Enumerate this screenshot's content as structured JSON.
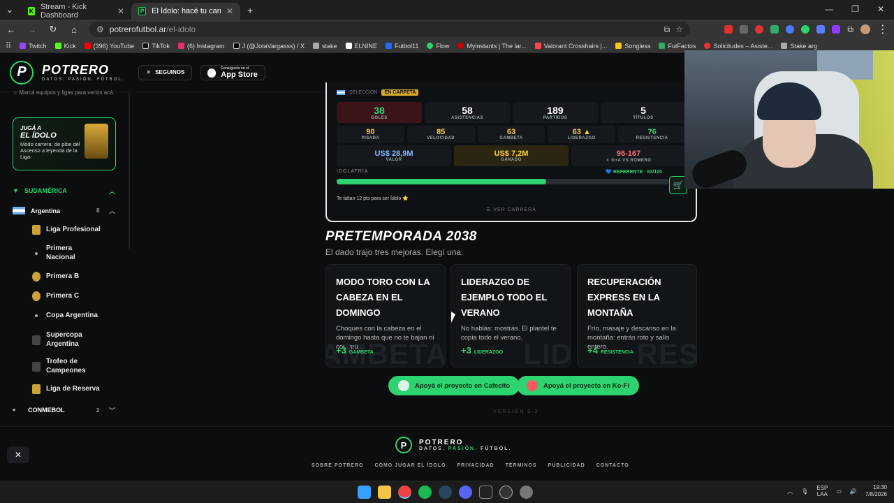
{
  "browser": {
    "tabs": [
      {
        "label": "Stream - Kick Dashboard",
        "active": false
      },
      {
        "label": "El Ídolo: hacé tu carrera en la Li",
        "active": true
      }
    ],
    "new_tab": "+",
    "url_host": "potrerofutbol.ar",
    "url_path": "/el-idolo",
    "bookmarks": [
      "Twitch",
      "Kick",
      "(396) YouTube",
      "TikTok",
      "(6) Instagram",
      "J (@JotaVargasss) / X",
      "stake",
      "ELNINE",
      "Futbol11",
      "Flow",
      "Myinstants | The lar...",
      "Valorant Crosshairs |...",
      "Songless",
      "FutFactos",
      "Solicitudes – Asiste...",
      "Stake arg"
    ]
  },
  "site": {
    "logo_letter": "P",
    "name": "POTRERO",
    "tagline": "DATOS. PASIÓN. FÚTBOL.",
    "follow_label": "SEGUINOS",
    "appstore_small": "Consiguelo en el",
    "appstore_big": "App Store"
  },
  "sidebar": {
    "note": "Marcá equipos y ligas para verlos acá.",
    "promo_kicker": "JUGÁ A",
    "promo_title": "EL ÍDOLO",
    "promo_desc": "Modo carrera: de pibe del Ascenso a leyenda de la Liga",
    "region": "SUDAMÉRICA",
    "country": "Argentina",
    "country_count": "8",
    "leagues": [
      "Liga Profesional",
      "Primera Nacional",
      "Primera B",
      "Primera C",
      "Copa Argentina",
      "Supercopa Argentina",
      "Trofeo de Campeones",
      "Liga de Reserva"
    ],
    "conmebol": "CONMEBOL",
    "conmebol_count": "2"
  },
  "career": {
    "selection": "SELECCIÓN",
    "status_badge": "EN CARPETA",
    "main_stats": [
      {
        "value": "38",
        "label": "GOLES"
      },
      {
        "value": "58",
        "label": "ASISTENCIAS"
      },
      {
        "value": "189",
        "label": "PARTIDOS"
      },
      {
        "value": "5",
        "label": "TÍTULOS"
      }
    ],
    "attrs": [
      {
        "value": "90",
        "label": "PISADA"
      },
      {
        "value": "85",
        "label": "VELOCIDAD"
      },
      {
        "value": "63",
        "label": "GAMBETA"
      },
      {
        "value": "63 ▲",
        "label": "LIDERAZGO"
      },
      {
        "value": "76",
        "label": "RESISTENCIA"
      }
    ],
    "valor": "US$ 28,9M",
    "valor_label": "VALOR",
    "ganado": "US$ 7,2M",
    "ganado_label": "GANADO",
    "rival_score": "96-167",
    "rival_label": "✕ G+A VS ROMERO",
    "idolatry_label": "IDOLATRÍA",
    "referente": "💙 REFERENTE · 63/100",
    "idolatry_pct": 63,
    "faltan": "Te faltan 12 pts para ser Ídolo ⭐",
    "ver_carrera": "☰ VER CARRERA"
  },
  "preseason": {
    "title": "PRETEMPORADA 2038",
    "subtitle": "El dado trajo tres mejoras. Elegí una.",
    "options": [
      {
        "title": "MODO TORO CON LA CABEZA EN EL DOMINGO",
        "desc": "Choques con la cabeza en el domingo hasta que no te bajan ni con grúa.",
        "bonus": "+3",
        "stat": "GAMBETA",
        "watermark": "GAMBETA"
      },
      {
        "title": "LIDERAZGO DE EJEMPLO TODO EL VERANO",
        "desc": "No hablás: mostrás. El plantel te copia todo el verano.",
        "bonus": "+3",
        "stat": "LIDERAZGO",
        "watermark": "LID"
      },
      {
        "title": "RECUPERACIÓN EXPRESS EN LA MONTAÑA",
        "desc": "Frío, masaje y descanso en la montaña: entrás roto y salís entero.",
        "bonus": "+4",
        "stat": "RESISTENCIA",
        "watermark": "RES"
      }
    ]
  },
  "support": {
    "cafecito": "Apoyá el proyecto en Cafecito",
    "kofi": "Apoyá el proyecto en Ko-Fi",
    "version": "VERSIÓN 2.3"
  },
  "footer": {
    "name": "POTRERO",
    "tag1": "DATOS.",
    "tag2": "PASIÓN.",
    "tag3": "FÚTBOL.",
    "links": [
      "SOBRE POTRERO",
      "CÓMO JUGAR EL ÍDOLO",
      "PRIVACIDAD",
      "TÉRMINOS",
      "PUBLICIDAD",
      "CONTACTO"
    ]
  },
  "taskbar": {
    "lang1": "ESP",
    "lang2": "LAA",
    "time": "19:30",
    "date": "7/8/2026"
  },
  "colors": {
    "accent": "#2dd36f",
    "gold": "#ffd23f",
    "danger": "#ff6b6b"
  }
}
